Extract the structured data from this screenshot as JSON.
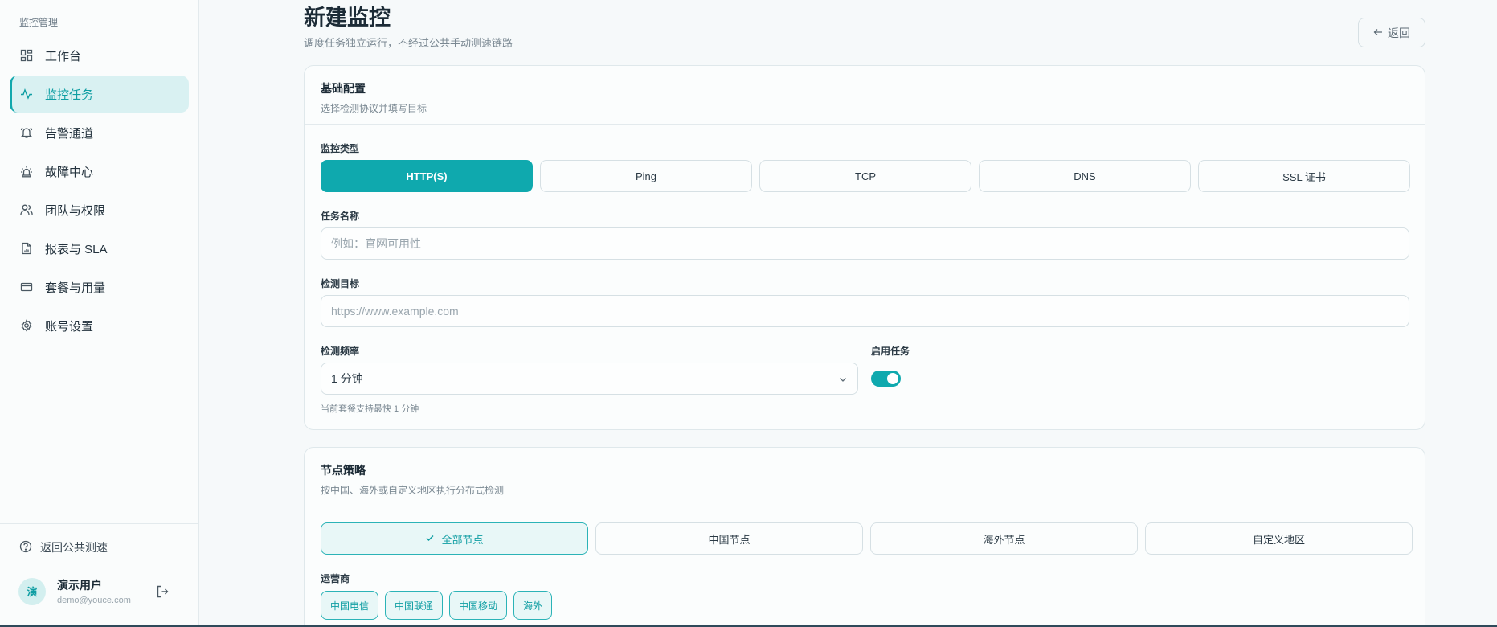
{
  "sidebar": {
    "section_title": "监控管理",
    "items": [
      {
        "label": "工作台",
        "icon": "dashboard-icon"
      },
      {
        "label": "监控任务",
        "icon": "activity-icon",
        "active": true
      },
      {
        "label": "告警通道",
        "icon": "bell-icon"
      },
      {
        "label": "故障中心",
        "icon": "siren-icon"
      },
      {
        "label": "团队与权限",
        "icon": "users-icon"
      },
      {
        "label": "报表与 SLA",
        "icon": "file-chart-icon"
      },
      {
        "label": "套餐与用量",
        "icon": "credit-card-icon"
      },
      {
        "label": "账号设置",
        "icon": "gear-icon"
      }
    ],
    "back_public": "返回公共测速",
    "user": {
      "avatar_char": "演",
      "name": "演示用户",
      "email": "demo@youce.com"
    }
  },
  "header": {
    "title": "新建监控",
    "subtitle": "调度任务独立运行，不经过公共手动测速链路",
    "back_label": "返回"
  },
  "basic": {
    "title": "基础配置",
    "desc": "选择检测协议并填写目标",
    "type_label": "监控类型",
    "types": [
      "HTTP(S)",
      "Ping",
      "TCP",
      "DNS",
      "SSL 证书"
    ],
    "selected_type": "HTTP(S)",
    "name_label": "任务名称",
    "name_placeholder": "例如：官网可用性",
    "target_label": "检测目标",
    "target_placeholder": "https://www.example.com",
    "freq_label": "检测频率",
    "freq_value": "1 分钟",
    "freq_hint": "当前套餐支持最快 1 分钟",
    "enable_label": "启用任务",
    "enabled": true
  },
  "nodes": {
    "title": "节点策略",
    "desc": "按中国、海外或自定义地区执行分布式检测",
    "options": [
      "全部节点",
      "中国节点",
      "海外节点",
      "自定义地区"
    ],
    "selected": "全部节点",
    "carrier_label": "运营商",
    "carriers": [
      "中国电信",
      "中国联通",
      "中国移动",
      "海外"
    ]
  },
  "colors": {
    "accent": "#0fa9ae",
    "accent_light": "#d9f1f2"
  }
}
